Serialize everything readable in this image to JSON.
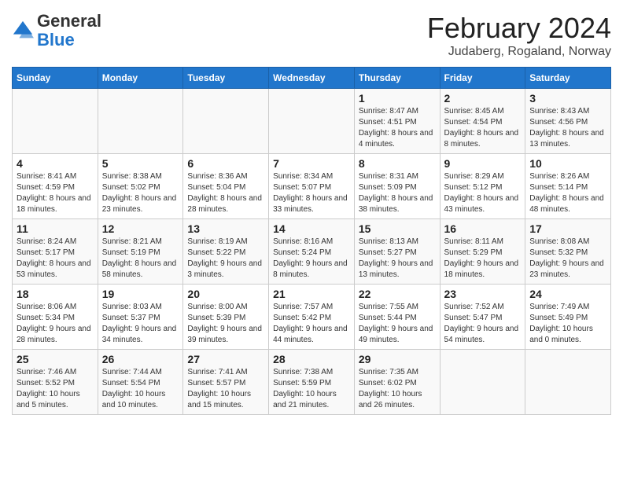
{
  "logo": {
    "general": "General",
    "blue": "Blue"
  },
  "title": "February 2024",
  "subtitle": "Judaberg, Rogaland, Norway",
  "headers": [
    "Sunday",
    "Monday",
    "Tuesday",
    "Wednesday",
    "Thursday",
    "Friday",
    "Saturday"
  ],
  "weeks": [
    [
      {
        "day": "",
        "sunrise": "",
        "sunset": "",
        "daylight": ""
      },
      {
        "day": "",
        "sunrise": "",
        "sunset": "",
        "daylight": ""
      },
      {
        "day": "",
        "sunrise": "",
        "sunset": "",
        "daylight": ""
      },
      {
        "day": "",
        "sunrise": "",
        "sunset": "",
        "daylight": ""
      },
      {
        "day": "1",
        "sunrise": "Sunrise: 8:47 AM",
        "sunset": "Sunset: 4:51 PM",
        "daylight": "Daylight: 8 hours and 4 minutes."
      },
      {
        "day": "2",
        "sunrise": "Sunrise: 8:45 AM",
        "sunset": "Sunset: 4:54 PM",
        "daylight": "Daylight: 8 hours and 8 minutes."
      },
      {
        "day": "3",
        "sunrise": "Sunrise: 8:43 AM",
        "sunset": "Sunset: 4:56 PM",
        "daylight": "Daylight: 8 hours and 13 minutes."
      }
    ],
    [
      {
        "day": "4",
        "sunrise": "Sunrise: 8:41 AM",
        "sunset": "Sunset: 4:59 PM",
        "daylight": "Daylight: 8 hours and 18 minutes."
      },
      {
        "day": "5",
        "sunrise": "Sunrise: 8:38 AM",
        "sunset": "Sunset: 5:02 PM",
        "daylight": "Daylight: 8 hours and 23 minutes."
      },
      {
        "day": "6",
        "sunrise": "Sunrise: 8:36 AM",
        "sunset": "Sunset: 5:04 PM",
        "daylight": "Daylight: 8 hours and 28 minutes."
      },
      {
        "day": "7",
        "sunrise": "Sunrise: 8:34 AM",
        "sunset": "Sunset: 5:07 PM",
        "daylight": "Daylight: 8 hours and 33 minutes."
      },
      {
        "day": "8",
        "sunrise": "Sunrise: 8:31 AM",
        "sunset": "Sunset: 5:09 PM",
        "daylight": "Daylight: 8 hours and 38 minutes."
      },
      {
        "day": "9",
        "sunrise": "Sunrise: 8:29 AM",
        "sunset": "Sunset: 5:12 PM",
        "daylight": "Daylight: 8 hours and 43 minutes."
      },
      {
        "day": "10",
        "sunrise": "Sunrise: 8:26 AM",
        "sunset": "Sunset: 5:14 PM",
        "daylight": "Daylight: 8 hours and 48 minutes."
      }
    ],
    [
      {
        "day": "11",
        "sunrise": "Sunrise: 8:24 AM",
        "sunset": "Sunset: 5:17 PM",
        "daylight": "Daylight: 8 hours and 53 minutes."
      },
      {
        "day": "12",
        "sunrise": "Sunrise: 8:21 AM",
        "sunset": "Sunset: 5:19 PM",
        "daylight": "Daylight: 8 hours and 58 minutes."
      },
      {
        "day": "13",
        "sunrise": "Sunrise: 8:19 AM",
        "sunset": "Sunset: 5:22 PM",
        "daylight": "Daylight: 9 hours and 3 minutes."
      },
      {
        "day": "14",
        "sunrise": "Sunrise: 8:16 AM",
        "sunset": "Sunset: 5:24 PM",
        "daylight": "Daylight: 9 hours and 8 minutes."
      },
      {
        "day": "15",
        "sunrise": "Sunrise: 8:13 AM",
        "sunset": "Sunset: 5:27 PM",
        "daylight": "Daylight: 9 hours and 13 minutes."
      },
      {
        "day": "16",
        "sunrise": "Sunrise: 8:11 AM",
        "sunset": "Sunset: 5:29 PM",
        "daylight": "Daylight: 9 hours and 18 minutes."
      },
      {
        "day": "17",
        "sunrise": "Sunrise: 8:08 AM",
        "sunset": "Sunset: 5:32 PM",
        "daylight": "Daylight: 9 hours and 23 minutes."
      }
    ],
    [
      {
        "day": "18",
        "sunrise": "Sunrise: 8:06 AM",
        "sunset": "Sunset: 5:34 PM",
        "daylight": "Daylight: 9 hours and 28 minutes."
      },
      {
        "day": "19",
        "sunrise": "Sunrise: 8:03 AM",
        "sunset": "Sunset: 5:37 PM",
        "daylight": "Daylight: 9 hours and 34 minutes."
      },
      {
        "day": "20",
        "sunrise": "Sunrise: 8:00 AM",
        "sunset": "Sunset: 5:39 PM",
        "daylight": "Daylight: 9 hours and 39 minutes."
      },
      {
        "day": "21",
        "sunrise": "Sunrise: 7:57 AM",
        "sunset": "Sunset: 5:42 PM",
        "daylight": "Daylight: 9 hours and 44 minutes."
      },
      {
        "day": "22",
        "sunrise": "Sunrise: 7:55 AM",
        "sunset": "Sunset: 5:44 PM",
        "daylight": "Daylight: 9 hours and 49 minutes."
      },
      {
        "day": "23",
        "sunrise": "Sunrise: 7:52 AM",
        "sunset": "Sunset: 5:47 PM",
        "daylight": "Daylight: 9 hours and 54 minutes."
      },
      {
        "day": "24",
        "sunrise": "Sunrise: 7:49 AM",
        "sunset": "Sunset: 5:49 PM",
        "daylight": "Daylight: 10 hours and 0 minutes."
      }
    ],
    [
      {
        "day": "25",
        "sunrise": "Sunrise: 7:46 AM",
        "sunset": "Sunset: 5:52 PM",
        "daylight": "Daylight: 10 hours and 5 minutes."
      },
      {
        "day": "26",
        "sunrise": "Sunrise: 7:44 AM",
        "sunset": "Sunset: 5:54 PM",
        "daylight": "Daylight: 10 hours and 10 minutes."
      },
      {
        "day": "27",
        "sunrise": "Sunrise: 7:41 AM",
        "sunset": "Sunset: 5:57 PM",
        "daylight": "Daylight: 10 hours and 15 minutes."
      },
      {
        "day": "28",
        "sunrise": "Sunrise: 7:38 AM",
        "sunset": "Sunset: 5:59 PM",
        "daylight": "Daylight: 10 hours and 21 minutes."
      },
      {
        "day": "29",
        "sunrise": "Sunrise: 7:35 AM",
        "sunset": "Sunset: 6:02 PM",
        "daylight": "Daylight: 10 hours and 26 minutes."
      },
      {
        "day": "",
        "sunrise": "",
        "sunset": "",
        "daylight": ""
      },
      {
        "day": "",
        "sunrise": "",
        "sunset": "",
        "daylight": ""
      }
    ]
  ]
}
